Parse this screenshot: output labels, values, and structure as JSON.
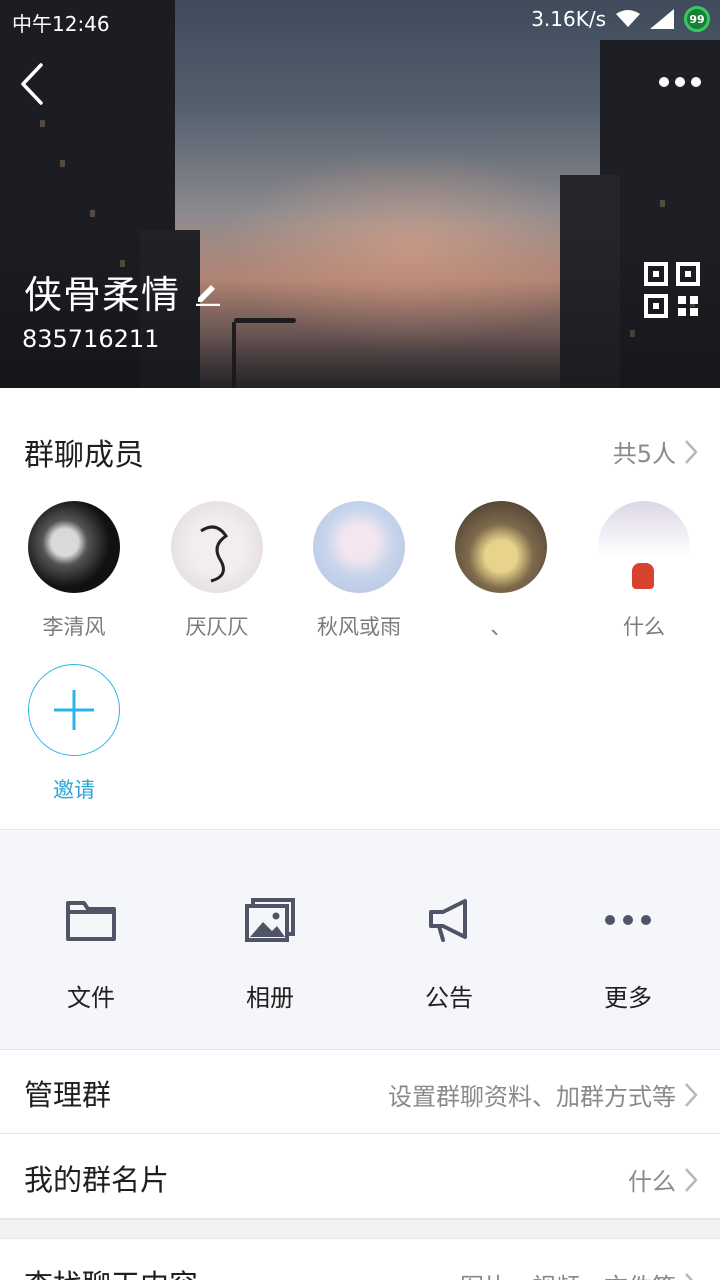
{
  "status_bar": {
    "time": "中午12:46",
    "network_speed": "3.16K/s",
    "battery_level": "99",
    "icons": [
      "wifi-icon",
      "signal-icon",
      "battery-icon"
    ]
  },
  "header": {
    "back_icon": "chevron-left-icon",
    "more_icon": "more-dots-icon",
    "group_name": "侠骨柔情",
    "edit_icon": "pencil-icon",
    "group_id": "835716211",
    "qr_icon": "qr-code-icon"
  },
  "members": {
    "title": "群聊成员",
    "count_label": "共5人",
    "list": [
      {
        "name": "李清风"
      },
      {
        "name": "厌仄仄"
      },
      {
        "name": "秋风或雨"
      },
      {
        "name": "、"
      },
      {
        "name": "什么"
      }
    ],
    "invite_label": "邀请"
  },
  "actions": [
    {
      "label": "文件",
      "icon": "folder-icon"
    },
    {
      "label": "相册",
      "icon": "album-icon"
    },
    {
      "label": "公告",
      "icon": "megaphone-icon"
    },
    {
      "label": "更多",
      "icon": "more-dots-icon"
    }
  ],
  "rows": {
    "manage": {
      "title": "管理群",
      "value": "设置群聊资料、加群方式等"
    },
    "card": {
      "title": "我的群名片",
      "value": "什么"
    },
    "search": {
      "title": "查找聊天内容",
      "value": "图片、视频、文件等"
    }
  },
  "colors": {
    "accent": "#2bb4e7",
    "action_icon": "#4f5566",
    "action_bg": "#f5f6f9"
  }
}
